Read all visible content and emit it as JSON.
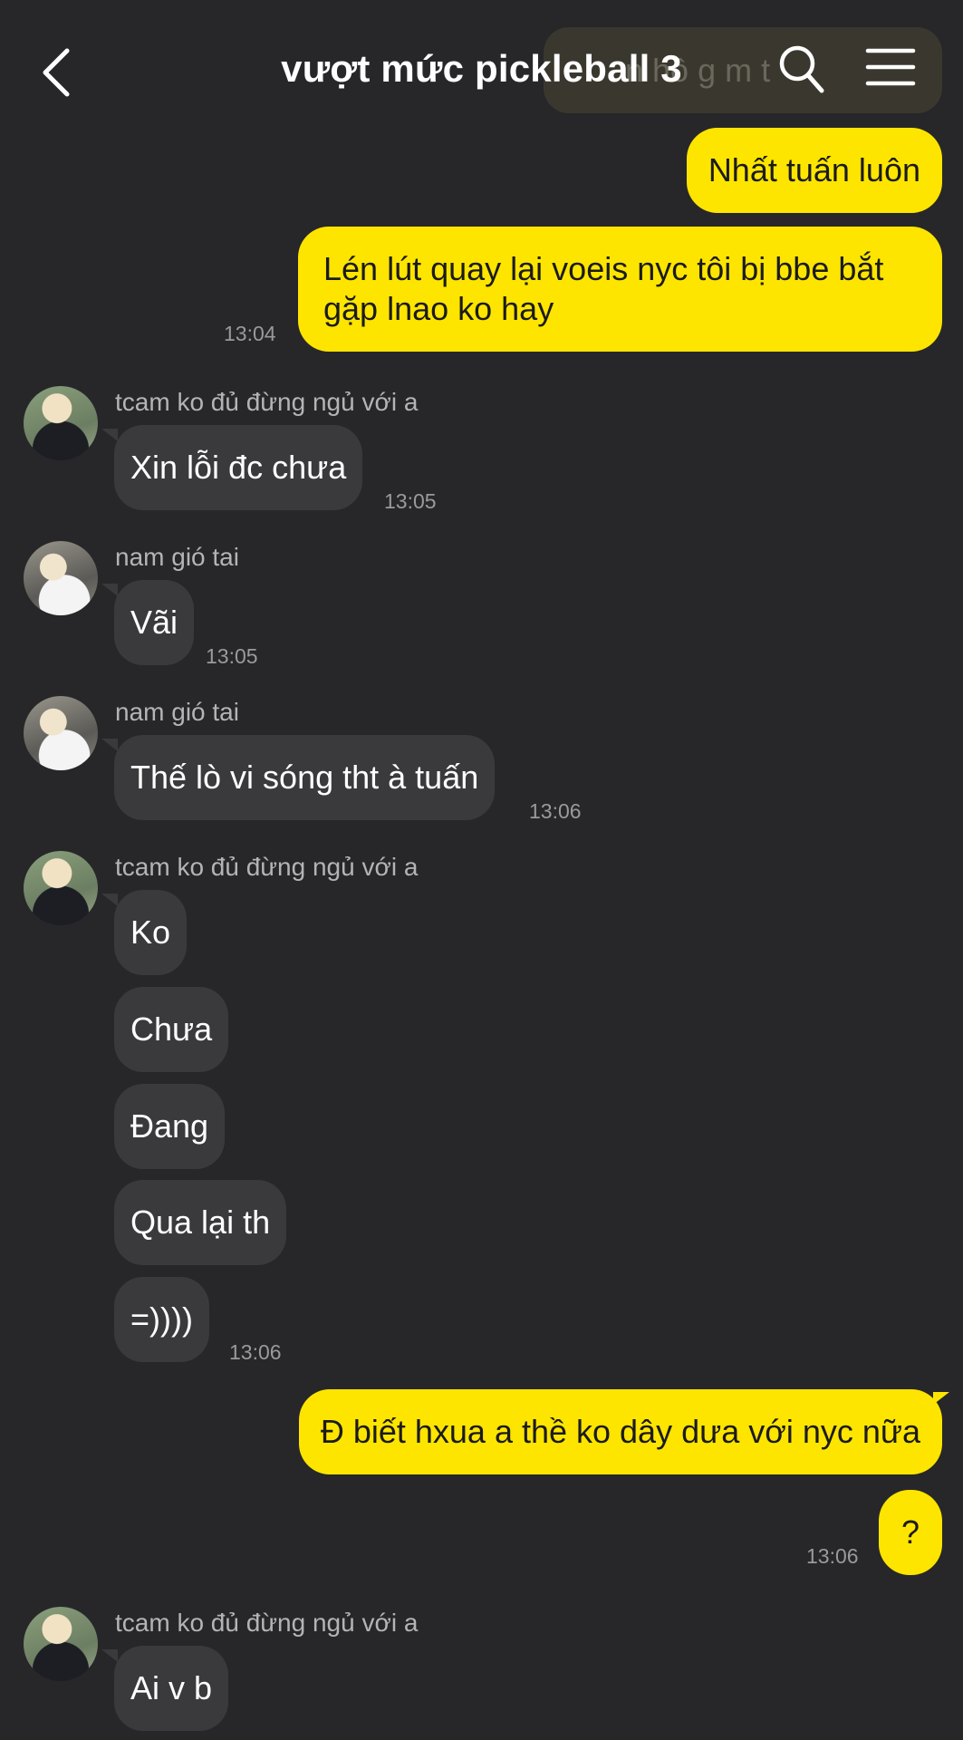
{
  "header": {
    "title": "vượt mức pickleball 3",
    "back_icon": "chevron-left-icon",
    "search_icon": "search-icon",
    "menu_icon": "menu-icon"
  },
  "ghost_text": "n hồ g  m t",
  "messages": [
    {
      "text": "Nhất tuấn luôn"
    },
    {
      "text": "Lén lút quay lại voeis nyc tôi bị bbe bắt gặp lnao ko hay",
      "time": "13:04"
    },
    {
      "sender": "tcam ko đủ đừng ngủ với a",
      "text": "Xin lỗi đc chưa",
      "time": "13:05"
    },
    {
      "sender": "nam gió tai",
      "text": "Vãi",
      "time": "13:05"
    },
    {
      "sender": "nam gió tai",
      "text": "Thế lò vi sóng tht à tuấn",
      "time": "13:06"
    },
    {
      "sender": "tcam ko đủ đừng ngủ với a",
      "texts": [
        "Ko",
        "Chưa",
        "Đang",
        "Qua lại th",
        "=))))"
      ],
      "time": "13:06"
    },
    {
      "text": "Đ biết hxua a thề ko dây dưa với nyc nữa"
    },
    {
      "text": "?",
      "time": "13:06"
    },
    {
      "sender": "tcam ko đủ đừng ngủ với a",
      "text": "Ai v b"
    }
  ],
  "colors": {
    "background": "#27272a",
    "my_bubble": "#fee500",
    "their_bubble": "#3a3a3c"
  }
}
